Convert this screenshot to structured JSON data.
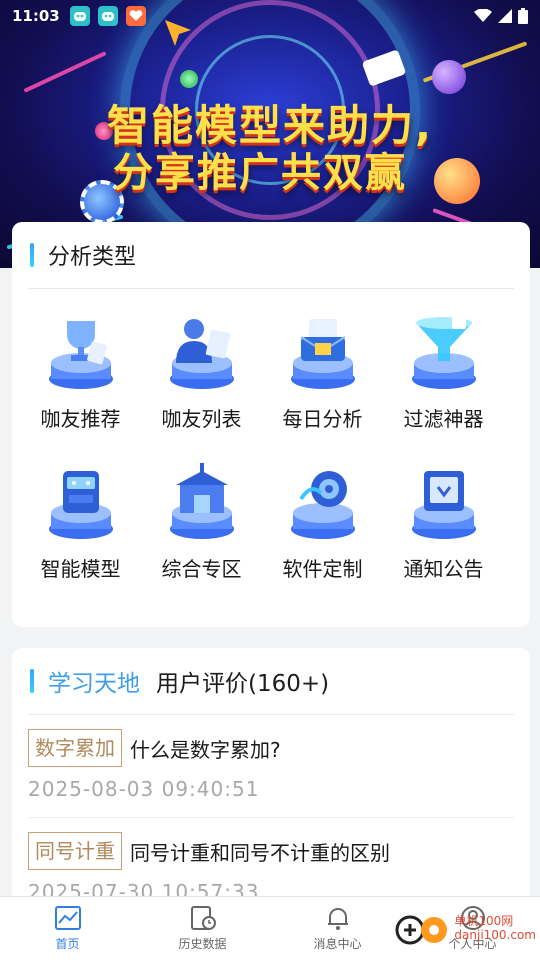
{
  "status_bar": {
    "time": "11:03"
  },
  "banner": {
    "line1": "智能模型来助力,",
    "line2": "分享推广共双赢"
  },
  "analysis": {
    "title": "分析类型",
    "items": [
      {
        "label": "咖友推荐",
        "icon": "trophy-icon"
      },
      {
        "label": "咖友列表",
        "icon": "people-icon"
      },
      {
        "label": "每日分析",
        "icon": "mail-icon"
      },
      {
        "label": "过滤神器",
        "icon": "funnel-icon"
      },
      {
        "label": "智能模型",
        "icon": "robot-icon"
      },
      {
        "label": "综合专区",
        "icon": "store-icon"
      },
      {
        "label": "软件定制",
        "icon": "gear-icon"
      },
      {
        "label": "通知公告",
        "icon": "notice-icon"
      }
    ]
  },
  "study": {
    "tab_active": "学习天地",
    "tab_other": "用户评价(160+)",
    "items": [
      {
        "tag": "数字累加",
        "question": "什么是数字累加?",
        "time": "2025-08-03 09:40:51"
      },
      {
        "tag": "同号计重",
        "question": "同号计重和同号不计重的区别",
        "time": "2025-07-30 10:57:33"
      }
    ]
  },
  "nav": {
    "items": [
      {
        "label": "首页"
      },
      {
        "label": "历史数据"
      },
      {
        "label": "消息中心"
      },
      {
        "label": "个人中心"
      }
    ]
  },
  "watermark": {
    "line1": "单机100网",
    "line2": "danji100.com"
  },
  "colors": {
    "accent": "#3e9ee6",
    "tag": "#b08a5c",
    "nav_active": "#2f7fe0"
  }
}
